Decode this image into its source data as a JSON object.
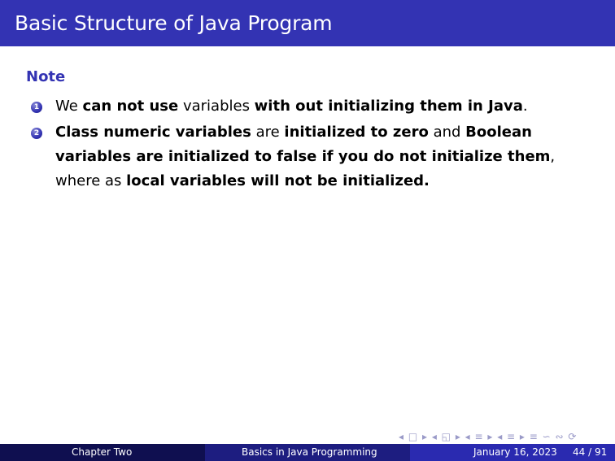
{
  "slide": {
    "title": "Basic Structure of Java Program",
    "block_title": "Note",
    "items": [
      {
        "number": "1",
        "lines": [
          [
            "We ",
            "can not use",
            " variables ",
            "with out initializing them in Java",
            "."
          ]
        ]
      },
      {
        "number": "2",
        "lines": [
          [
            " Class numeric variables",
            " are ",
            "initialized to zero",
            " and ",
            "Boolean"
          ],
          [
            "variables are initialized to false if you do not initialize them",
            ","
          ],
          [
            "where as ",
            "local variables will not be initialized."
          ]
        ]
      }
    ]
  },
  "footer": {
    "left": "Chapter Two",
    "center": "Basics in Java Programming",
    "date": "January 16, 2023",
    "page": "44 / 91"
  },
  "navigation": {
    "symbols": "◂ □ ▸ ◂ ◱ ▸ ◂ ≡ ▸ ◂ ≡ ▸ ≡ ∽ ∾ ⟳"
  },
  "colors": {
    "accent": "#3333b3",
    "footer_dark": "#0f0f50",
    "footer_mid": "#1d1d80",
    "footer_light": "#2a2ab0"
  }
}
